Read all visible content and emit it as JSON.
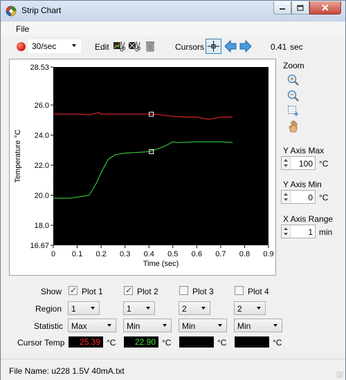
{
  "window": {
    "title": "Strip Chart"
  },
  "menu": {
    "file": "File"
  },
  "toolbar": {
    "rate": "30/sec",
    "edit_label": "Edit",
    "cursors_label": "Cursors",
    "cursor_time": "0.41",
    "cursor_time_unit": "sec"
  },
  "side": {
    "zoom_label": "Zoom",
    "y_axis_max_label": "Y Axis Max",
    "y_axis_max": "100",
    "y_axis_max_unit": "°C",
    "y_axis_min_label": "Y Axis Min",
    "y_axis_min": "0",
    "y_axis_min_unit": "°C",
    "x_axis_range_label": "X Axis Range",
    "x_axis_range": "1",
    "x_axis_range_unit": "min"
  },
  "chart_data": {
    "type": "line",
    "xlabel": "Time (sec)",
    "ylabel": "Temperature °C",
    "xlim": [
      0,
      0.9
    ],
    "ylim": [
      16.67,
      28.53
    ],
    "x_ticks": [
      "0",
      "0.1",
      "0.2",
      "0.3",
      "0.4",
      "0.5",
      "0.6",
      "0.7",
      "0.8",
      "0.9"
    ],
    "y_ticks": [
      "28.53",
      "26.0",
      "24.0",
      "22.0",
      "20.0",
      "18.0",
      "16.67"
    ],
    "background": "#000000",
    "series": [
      {
        "color": "#ff2a2a",
        "x": [
          0,
          0.1,
          0.15,
          0.19,
          0.2,
          0.25,
          0.3,
          0.35,
          0.4,
          0.45,
          0.5,
          0.55,
          0.6,
          0.65,
          0.7,
          0.75
        ],
        "y": [
          25.4,
          25.4,
          25.35,
          25.5,
          25.4,
          25.4,
          25.4,
          25.4,
          25.4,
          25.35,
          25.25,
          25.2,
          25.2,
          25.05,
          25.2,
          25.2
        ]
      },
      {
        "color": "#3ce63c",
        "x": [
          0,
          0.07,
          0.15,
          0.18,
          0.2,
          0.23,
          0.26,
          0.3,
          0.35,
          0.4,
          0.44,
          0.47,
          0.5,
          0.52,
          0.6,
          0.7,
          0.75
        ],
        "y": [
          19.8,
          19.8,
          20.0,
          20.8,
          21.5,
          22.4,
          22.7,
          22.8,
          22.85,
          22.9,
          23.1,
          23.3,
          23.55,
          23.5,
          23.55,
          23.55,
          23.5
        ]
      }
    ],
    "cursor": {
      "x": 0.41,
      "markers": [
        25.39,
        22.9
      ]
    }
  },
  "controls": {
    "show_label": "Show",
    "region_label": "Region",
    "statistic_label": "Statistic",
    "cursor_temp_label": "Cursor Temp",
    "temp_unit": "°C",
    "plots": [
      {
        "name": "Plot 1",
        "checked": true,
        "region": "1",
        "statistic": "Max",
        "cursor_temp": "25.39",
        "temp_color": "#ff2a2a"
      },
      {
        "name": "Plot 2",
        "checked": true,
        "region": "1",
        "statistic": "Min",
        "cursor_temp": "22.90",
        "temp_color": "#3ce63c"
      },
      {
        "name": "Plot 3",
        "checked": false,
        "region": "2",
        "statistic": "Min",
        "cursor_temp": "",
        "temp_color": "#ffffff"
      },
      {
        "name": "Plot 4",
        "checked": false,
        "region": "2",
        "statistic": "Min",
        "cursor_temp": "",
        "temp_color": "#ffffff"
      }
    ]
  },
  "status": {
    "file_name": "File Name:  u228 1.5V 40mA.txt"
  }
}
